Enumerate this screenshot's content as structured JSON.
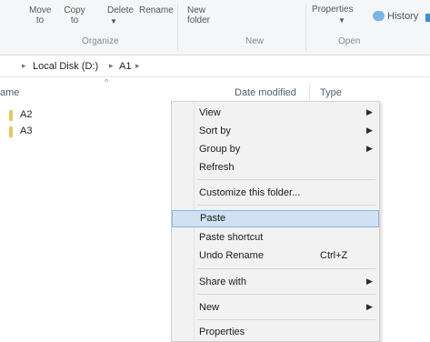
{
  "ribbon": {
    "organize": {
      "label": "Organize",
      "move_to": "Move\nto",
      "copy_to": "Copy\nto",
      "delete": "Delete",
      "rename": "Rename"
    },
    "new": {
      "label": "New",
      "new_folder": "New\nfolder"
    },
    "open": {
      "label": "Open",
      "properties": "Properties",
      "history": "History"
    }
  },
  "address": {
    "drive": "Local Disk (D:)",
    "folder": "A1"
  },
  "columns": {
    "name": "ame",
    "date": "Date modified",
    "type": "Type"
  },
  "files": [
    {
      "name": "A2"
    },
    {
      "name": "A3"
    }
  ],
  "menu": {
    "view": "View",
    "sort_by": "Sort by",
    "group_by": "Group by",
    "refresh": "Refresh",
    "customize": "Customize this folder...",
    "paste": "Paste",
    "paste_shortcut": "Paste shortcut",
    "undo_rename": "Undo Rename",
    "undo_shortcut": "Ctrl+Z",
    "share_with": "Share with",
    "new": "New",
    "properties": "Properties"
  }
}
